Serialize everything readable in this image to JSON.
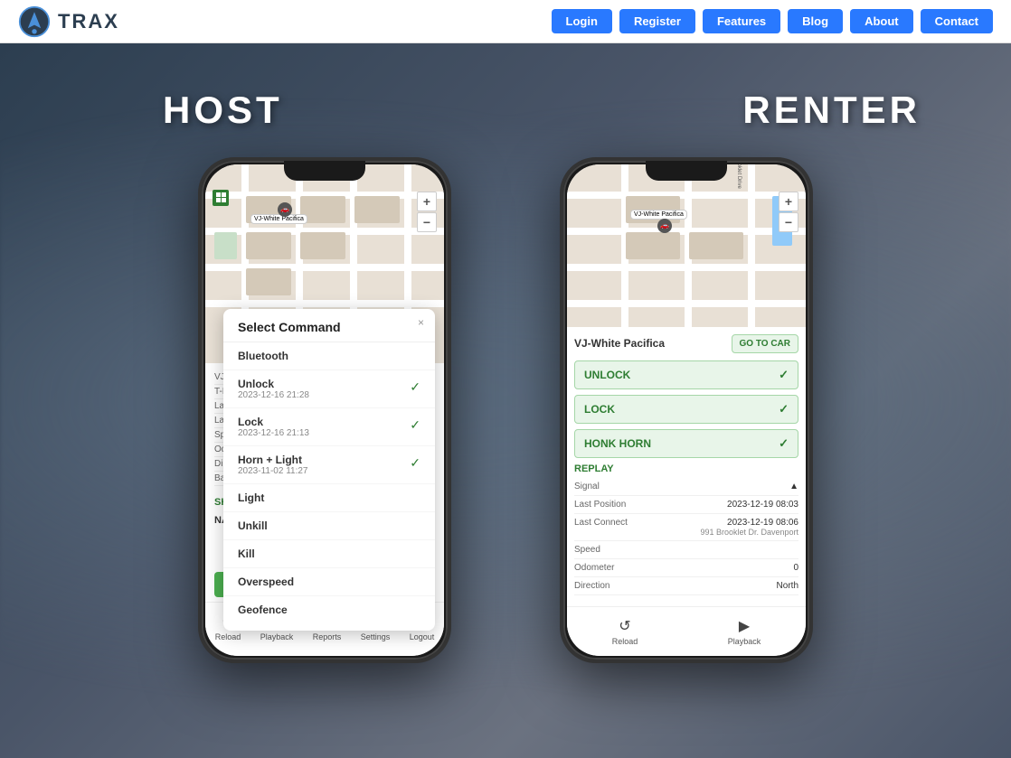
{
  "header": {
    "logo_text": "TRAX",
    "nav_buttons": [
      "Login",
      "Register",
      "Features",
      "Blog",
      "About",
      "Contact"
    ]
  },
  "hero": {
    "label_host": "HOST",
    "label_renter": "RENTER"
  },
  "host_phone": {
    "map": {
      "marker_text": "VJ-White Pacifica"
    },
    "info_rows": [
      {
        "label": "VJ-W",
        "value": ""
      },
      {
        "label": "T-Me",
        "value": ""
      },
      {
        "label": "Last",
        "value": ""
      },
      {
        "label": "Last",
        "value": ""
      },
      {
        "label": "Speed",
        "value": ""
      },
      {
        "label": "Odo",
        "value": ""
      },
      {
        "label": "Direc",
        "value": ""
      },
      {
        "label": "Batt",
        "value": ""
      }
    ],
    "share_label": "SHAR",
    "nav_label": "NAV",
    "bottom_nav": [
      {
        "icon": "↺",
        "label": "Reload"
      },
      {
        "icon": "▶",
        "label": "Playback"
      },
      {
        "icon": "📋",
        "label": "Reports"
      },
      {
        "icon": "✕",
        "label": "Settings"
      },
      {
        "icon": "⬚",
        "label": "Logout"
      }
    ]
  },
  "command_popup": {
    "title": "Select Command",
    "close_label": "×",
    "items": [
      {
        "name": "Bluetooth",
        "date": "",
        "checked": false
      },
      {
        "name": "Unlock",
        "date": "2023-12-16 21:28",
        "checked": true
      },
      {
        "name": "Lock",
        "date": "2023-12-16 21:13",
        "checked": true
      },
      {
        "name": "Horn + Light",
        "date": "2023-11-02 11:27",
        "checked": true
      },
      {
        "name": "Light",
        "date": "",
        "checked": false
      },
      {
        "name": "Unkill",
        "date": "",
        "checked": false
      },
      {
        "name": "Kill",
        "date": "",
        "checked": false
      },
      {
        "name": "Overspeed",
        "date": "",
        "checked": false
      },
      {
        "name": "Geofence",
        "date": "",
        "checked": false
      }
    ]
  },
  "renter_phone": {
    "map": {
      "marker_text": "VJ-White Pacifica"
    },
    "car_name": "VJ-White Pacifica",
    "goto_label": "GO TO CAR",
    "action_buttons": [
      "UNLOCK",
      "LOCK",
      "HONK HORN"
    ],
    "replay_label": "REPLAY",
    "info_rows": [
      {
        "label": "Signal",
        "value": "▲"
      },
      {
        "label": "Last Position",
        "value": "2023-12-19 08:03"
      },
      {
        "label": "Last Connect",
        "value": "2023-12-19 08:06\n991 Brooklet Dr. Davenport"
      },
      {
        "label": "Speed",
        "value": ""
      },
      {
        "label": "Odometer",
        "value": "0"
      },
      {
        "label": "Direction",
        "value": "North"
      }
    ],
    "bottom_nav": [
      {
        "icon": "↺",
        "label": "Reload"
      },
      {
        "icon": "▶",
        "label": "Playback"
      }
    ]
  }
}
